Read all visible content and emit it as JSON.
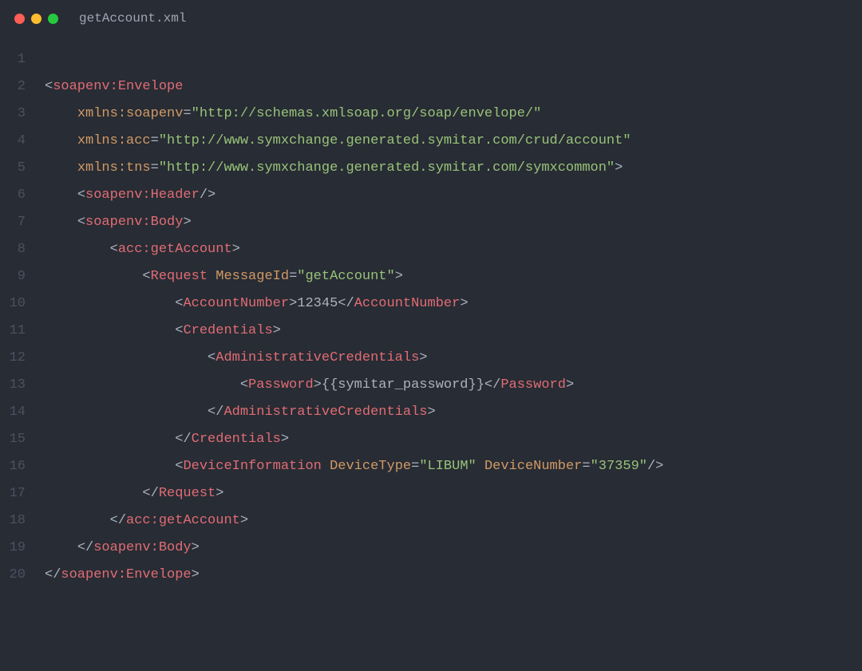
{
  "title": "getAccount.xml",
  "colors": {
    "background": "#282c34",
    "gutter": "#495162",
    "punct": "#abb2bf",
    "tag": "#e06c75",
    "attr": "#d19a66",
    "string": "#98c379"
  },
  "lineCount": 20,
  "code": {
    "line1": {
      "tag": "soapenv:Envelope"
    },
    "line2": {
      "indent": "    ",
      "attr": "xmlns:soapenv",
      "eq": "=",
      "val": "\"http://schemas.xmlsoap.org/soap/envelope/\""
    },
    "line3": {
      "indent": "    ",
      "attr": "xmlns:acc",
      "eq": "=",
      "val": "\"http://www.symxchange.generated.symitar.com/crud/account\""
    },
    "line4": {
      "indent": "    ",
      "attr": "xmlns:tns",
      "eq": "=",
      "val": "\"http://www.symxchange.generated.symitar.com/symxcommon\"",
      "close": ">"
    },
    "line5": {
      "indent": "    ",
      "tag": "soapenv:Header"
    },
    "line6": {
      "indent": "    ",
      "tag": "soapenv:Body"
    },
    "line7": {
      "indent": "        ",
      "tag": "acc:getAccount"
    },
    "line8": {
      "indent": "            ",
      "tag": "Request",
      "attr": "MessageId",
      "val": "\"getAccount\""
    },
    "line9": {
      "indent": "                ",
      "tag": "AccountNumber",
      "text": "12345"
    },
    "line10": {
      "indent": "                ",
      "tag": "Credentials"
    },
    "line11": {
      "indent": "                    ",
      "tag": "AdministrativeCredentials"
    },
    "line12": {
      "indent": "                        ",
      "tag": "Password",
      "text": "{{symitar_password}}"
    },
    "line13": {
      "indent": "                    ",
      "tag": "AdministrativeCredentials"
    },
    "line14": {
      "indent": "                ",
      "tag": "Credentials"
    },
    "line15": {
      "indent": "                ",
      "tag": "DeviceInformation",
      "attr1": "DeviceType",
      "val1": "\"LIBUM\"",
      "attr2": "DeviceNumber",
      "val2": "\"37359\""
    },
    "line16": {
      "indent": "            ",
      "tag": "Request"
    },
    "line17": {
      "indent": "        ",
      "tag": "acc:getAccount"
    },
    "line18": {
      "indent": "    ",
      "tag": "soapenv:Body"
    },
    "line19": {
      "tag": "soapenv:Envelope"
    }
  }
}
